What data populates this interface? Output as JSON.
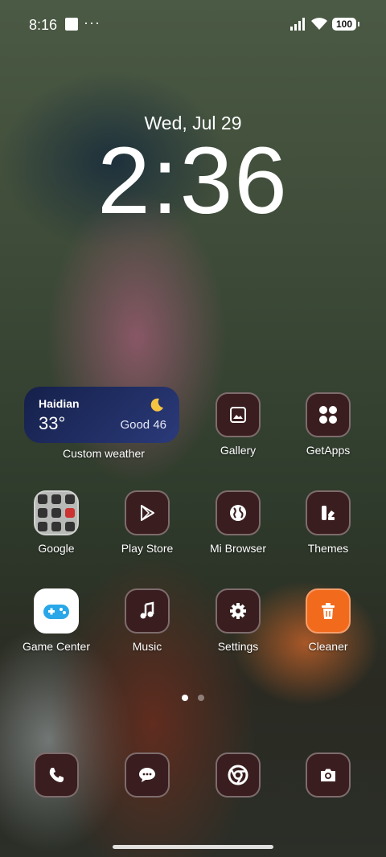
{
  "status_bar": {
    "time": "8:16",
    "overflow": "···",
    "battery": "100"
  },
  "lockscreen": {
    "date": "Wed, Jul 29",
    "time": "2:36"
  },
  "weather_widget": {
    "city": "Haidian",
    "temperature": "33°",
    "air_quality": "Good 46",
    "label": "Custom weather",
    "icon": "moon-icon"
  },
  "apps": [
    {
      "label": "Gallery",
      "icon": "gallery-icon"
    },
    {
      "label": "GetApps",
      "icon": "getapps-icon"
    },
    {
      "label": "Google",
      "icon": "folder-icon"
    },
    {
      "label": "Play Store",
      "icon": "play-store-icon"
    },
    {
      "label": "Mi Browser",
      "icon": "globe-icon"
    },
    {
      "label": "Themes",
      "icon": "themes-icon"
    },
    {
      "label": "Game Center",
      "icon": "gamepad-icon"
    },
    {
      "label": "Music",
      "icon": "music-note-icon"
    },
    {
      "label": "Settings",
      "icon": "gear-icon"
    },
    {
      "label": "Cleaner",
      "icon": "trash-icon"
    }
  ],
  "dock": [
    {
      "icon": "phone-icon"
    },
    {
      "icon": "messages-icon"
    },
    {
      "icon": "chrome-icon"
    },
    {
      "icon": "camera-icon"
    }
  ],
  "colors": {
    "icon_bg": "#3a1e1f",
    "cleaner_accent": "#f26b1d",
    "weather_bg": "#1d2a5e"
  }
}
